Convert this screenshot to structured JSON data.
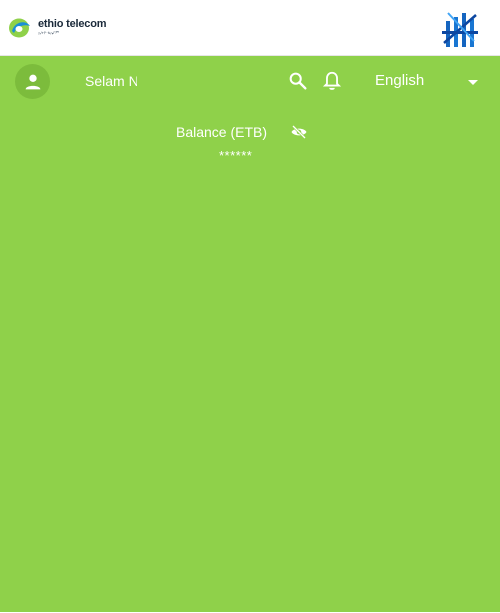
{
  "header": {
    "logo_text": "ethio telecom",
    "logo_subtext": "ኢትዮ ቴሌኮም",
    "logo_icon": "ethio-telecom-logo",
    "brand_icon": "building-brand-icon"
  },
  "toolbar": {
    "greeting": "Selam N",
    "avatar_icon": "person-icon",
    "search_icon": "search-icon",
    "notification_icon": "bell-icon",
    "language": "English",
    "language_caret_icon": "caret-down-icon"
  },
  "balance": {
    "label": "Balance (ETB)",
    "value": "******",
    "visibility_icon": "eye-off-icon"
  },
  "colors": {
    "main_background": "#8fd14a",
    "header_background": "#ffffff",
    "text_on_green": "#ffffff",
    "brand_blue": "#1565c0"
  }
}
